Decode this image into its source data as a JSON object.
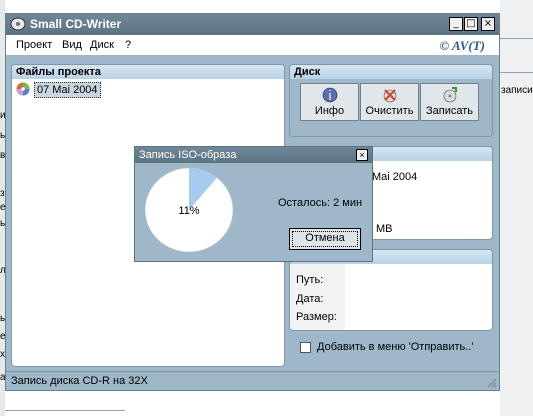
{
  "window": {
    "title": "Small CD-Writer",
    "controls": {
      "minimize": "_",
      "maximize": "□",
      "close": "×"
    }
  },
  "menu": {
    "items": [
      "Проект",
      "Вид",
      "Диск",
      "?"
    ],
    "brand": "© AV(T)"
  },
  "project_panel": {
    "header": "Файлы проекта",
    "files": [
      {
        "name": "07 Mai 2004",
        "icon": "cd-disc-icon"
      }
    ]
  },
  "disk_panel": {
    "header": "Диск",
    "buttons": [
      {
        "label": "Инфо",
        "icon": "info-icon"
      },
      {
        "label": "Очистить",
        "icon": "erase-icon"
      },
      {
        "label": "Записать",
        "icon": "burn-icon"
      }
    ]
  },
  "disk_info_panel": {
    "partial_name": "Mai 2004",
    "partial_size": "MB"
  },
  "file_info_panel": {
    "labels": [
      "Путь:",
      "Дата:",
      "Размер:"
    ]
  },
  "send_to_checkbox": {
    "label": "Добавить в меню 'Отправить..'",
    "checked": false
  },
  "status_bar": {
    "text": "Запись диска CD-R на 32X"
  },
  "dialog": {
    "title": "Запись ISO-образа",
    "close": "×",
    "progress_percent": 11,
    "progress_text": "11%",
    "remaining": "Осталось: 2 мин",
    "cancel_label": "Отмена"
  },
  "background": {
    "right_text": "записи",
    "left_fragments": [
      "и",
      "ь",
      "в",
      "з",
      "е",
      "ь",
      "л",
      "ь",
      "е",
      "х",
      "а"
    ]
  },
  "colors": {
    "window_bg": "#9fb8c9",
    "titlebar": "#5b7484",
    "panel_header": "#b8d2e6",
    "progress_fill": "#a6cbee"
  }
}
